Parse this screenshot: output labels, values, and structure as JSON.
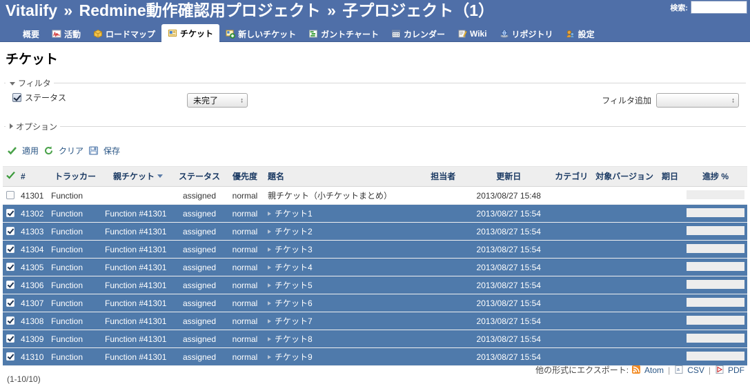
{
  "banner": {
    "crumb": [
      "Vitalify",
      "Redmine動作確認用プロジェクト",
      "子プロジェクト（1）"
    ],
    "separator": "»",
    "search_label": "検索:",
    "search_value": "",
    "search_placeholder": ""
  },
  "main_menu": [
    {
      "label": "概要",
      "icon": "overview-icon",
      "selected": false
    },
    {
      "label": "活動",
      "icon": "activity-icon",
      "selected": false
    },
    {
      "label": "ロードマップ",
      "icon": "roadmap-icon",
      "selected": false
    },
    {
      "label": "チケット",
      "icon": "issues-icon",
      "selected": true
    },
    {
      "label": "新しいチケット",
      "icon": "new-issue-icon",
      "selected": false
    },
    {
      "label": "ガントチャート",
      "icon": "gantt-icon",
      "selected": false
    },
    {
      "label": "カレンダー",
      "icon": "calendar-icon",
      "selected": false
    },
    {
      "label": "Wiki",
      "icon": "wiki-icon",
      "selected": false
    },
    {
      "label": "リポジトリ",
      "icon": "repository-icon",
      "selected": false
    },
    {
      "label": "設定",
      "icon": "settings-icon",
      "selected": false
    }
  ],
  "page_title": "チケット",
  "filters": {
    "legend": "フィルタ",
    "status_checkbox_checked": true,
    "status_label": "ステータス",
    "status_value": "未完了",
    "add_filter_label": "フィルタ追加",
    "add_filter_value": ""
  },
  "options": {
    "legend": "オプション"
  },
  "actions": {
    "apply": "適用",
    "clear": "クリア",
    "save": "保存"
  },
  "table": {
    "columns": [
      {
        "key": "check",
        "label": "",
        "icon": "check-all-icon"
      },
      {
        "key": "id",
        "label": "#"
      },
      {
        "key": "tracker",
        "label": "トラッカー"
      },
      {
        "key": "parent",
        "label": "親チケット",
        "sorted": "desc"
      },
      {
        "key": "status",
        "label": "ステータス"
      },
      {
        "key": "priority",
        "label": "優先度"
      },
      {
        "key": "subject",
        "label": "題名"
      },
      {
        "key": "assigned",
        "label": "担当者"
      },
      {
        "key": "updated",
        "label": "更新日"
      },
      {
        "key": "category",
        "label": "カテゴリ"
      },
      {
        "key": "version",
        "label": "対象バージョン"
      },
      {
        "key": "due",
        "label": "期日"
      },
      {
        "key": "done",
        "label": "進捗 %"
      }
    ],
    "rows": [
      {
        "selected": false,
        "checked": false,
        "id": "41301",
        "tracker": "Function",
        "parent": "",
        "status": "assigned",
        "priority": "normal",
        "subject": "親チケット（小チケットまとめ）",
        "child": false,
        "assigned": "",
        "updated": "2013/08/27 15:48",
        "category": "",
        "version": "",
        "due": "",
        "done": 0
      },
      {
        "selected": true,
        "checked": true,
        "id": "41302",
        "tracker": "Function",
        "parent": "Function #41301",
        "status": "assigned",
        "priority": "normal",
        "subject": "チケット1",
        "child": true,
        "assigned": "",
        "updated": "2013/08/27 15:54",
        "category": "",
        "version": "",
        "due": "",
        "done": 0
      },
      {
        "selected": true,
        "checked": true,
        "id": "41303",
        "tracker": "Function",
        "parent": "Function #41301",
        "status": "assigned",
        "priority": "normal",
        "subject": "チケット2",
        "child": true,
        "assigned": "",
        "updated": "2013/08/27 15:54",
        "category": "",
        "version": "",
        "due": "",
        "done": 0
      },
      {
        "selected": true,
        "checked": true,
        "id": "41304",
        "tracker": "Function",
        "parent": "Function #41301",
        "status": "assigned",
        "priority": "normal",
        "subject": "チケット3",
        "child": true,
        "assigned": "",
        "updated": "2013/08/27 15:54",
        "category": "",
        "version": "",
        "due": "",
        "done": 0
      },
      {
        "selected": true,
        "checked": true,
        "id": "41305",
        "tracker": "Function",
        "parent": "Function #41301",
        "status": "assigned",
        "priority": "normal",
        "subject": "チケット4",
        "child": true,
        "assigned": "",
        "updated": "2013/08/27 15:54",
        "category": "",
        "version": "",
        "due": "",
        "done": 0
      },
      {
        "selected": true,
        "checked": true,
        "id": "41306",
        "tracker": "Function",
        "parent": "Function #41301",
        "status": "assigned",
        "priority": "normal",
        "subject": "チケット5",
        "child": true,
        "assigned": "",
        "updated": "2013/08/27 15:54",
        "category": "",
        "version": "",
        "due": "",
        "done": 0
      },
      {
        "selected": true,
        "checked": true,
        "id": "41307",
        "tracker": "Function",
        "parent": "Function #41301",
        "status": "assigned",
        "priority": "normal",
        "subject": "チケット6",
        "child": true,
        "assigned": "",
        "updated": "2013/08/27 15:54",
        "category": "",
        "version": "",
        "due": "",
        "done": 0
      },
      {
        "selected": true,
        "checked": true,
        "id": "41308",
        "tracker": "Function",
        "parent": "Function #41301",
        "status": "assigned",
        "priority": "normal",
        "subject": "チケット7",
        "child": true,
        "assigned": "",
        "updated": "2013/08/27 15:54",
        "category": "",
        "version": "",
        "due": "",
        "done": 0
      },
      {
        "selected": true,
        "checked": true,
        "id": "41309",
        "tracker": "Function",
        "parent": "Function #41301",
        "status": "assigned",
        "priority": "normal",
        "subject": "チケット8",
        "child": true,
        "assigned": "",
        "updated": "2013/08/27 15:54",
        "category": "",
        "version": "",
        "due": "",
        "done": 0
      },
      {
        "selected": true,
        "checked": true,
        "id": "41310",
        "tracker": "Function",
        "parent": "Function #41301",
        "status": "assigned",
        "priority": "normal",
        "subject": "チケット9",
        "child": true,
        "assigned": "",
        "updated": "2013/08/27 15:54",
        "category": "",
        "version": "",
        "due": "",
        "done": 0
      }
    ]
  },
  "counts": "(1-10/10)",
  "other_formats": {
    "label": "他の形式にエクスポート:",
    "links": [
      {
        "label": "Atom",
        "icon": "atom-feed-icon"
      },
      {
        "label": "CSV",
        "icon": "csv-icon"
      },
      {
        "label": "PDF",
        "icon": "pdf-icon"
      }
    ],
    "separator": "|"
  },
  "colors": {
    "header_blue": "#4f6fa8",
    "selected_row": "#4f7aab",
    "link": "#2a5685",
    "th_text": "#1b3a63"
  }
}
